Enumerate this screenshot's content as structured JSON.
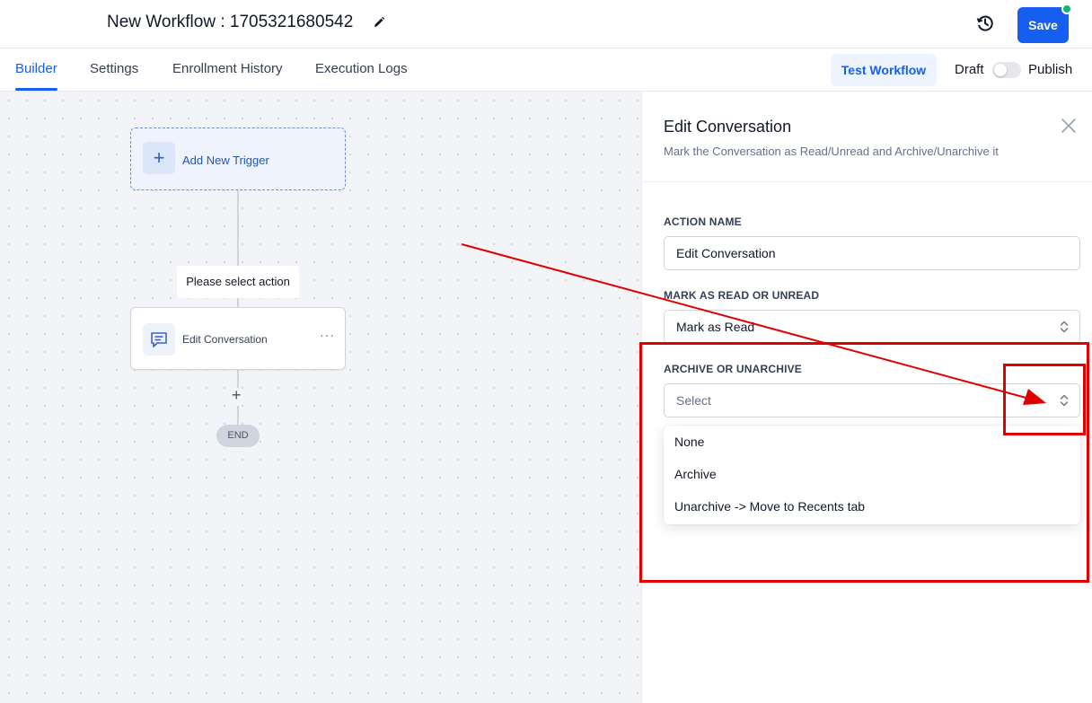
{
  "header": {
    "title": "New Workflow : 1705321680542",
    "save_label": "Save"
  },
  "tabs": {
    "builder": "Builder",
    "settings": "Settings",
    "enrollment_history": "Enrollment History",
    "execution_logs": "Execution Logs",
    "active": "Builder"
  },
  "toolbar": {
    "test_workflow": "Test Workflow",
    "draft": "Draft",
    "publish": "Publish",
    "published": false
  },
  "canvas": {
    "trigger_label": "Add New Trigger",
    "select_action_label": "Please select action",
    "action_label": "Edit Conversation",
    "action_more": "···",
    "add_step": "+",
    "end_label": "END"
  },
  "panel": {
    "title": "Edit Conversation",
    "subtitle": "Mark the Conversation as Read/Unread and Archive/Unarchive it",
    "action_name_label": "ACTION NAME",
    "action_name_value": "Edit Conversation",
    "read_label": "MARK AS READ OR UNREAD",
    "read_value": "Mark as Read",
    "archive_label": "ARCHIVE OR UNARCHIVE",
    "archive_placeholder": "Select",
    "archive_options": [
      "None",
      "Archive",
      "Unarchive -> Move to Recents tab"
    ]
  },
  "colors": {
    "primary": "#155eef",
    "annotation": "#e00000",
    "status_dot": "#12b76a"
  },
  "icons": [
    "pencil-icon",
    "history-icon",
    "plus-icon",
    "message-icon",
    "more-icon",
    "close-icon",
    "chevron-updown-icon"
  ]
}
